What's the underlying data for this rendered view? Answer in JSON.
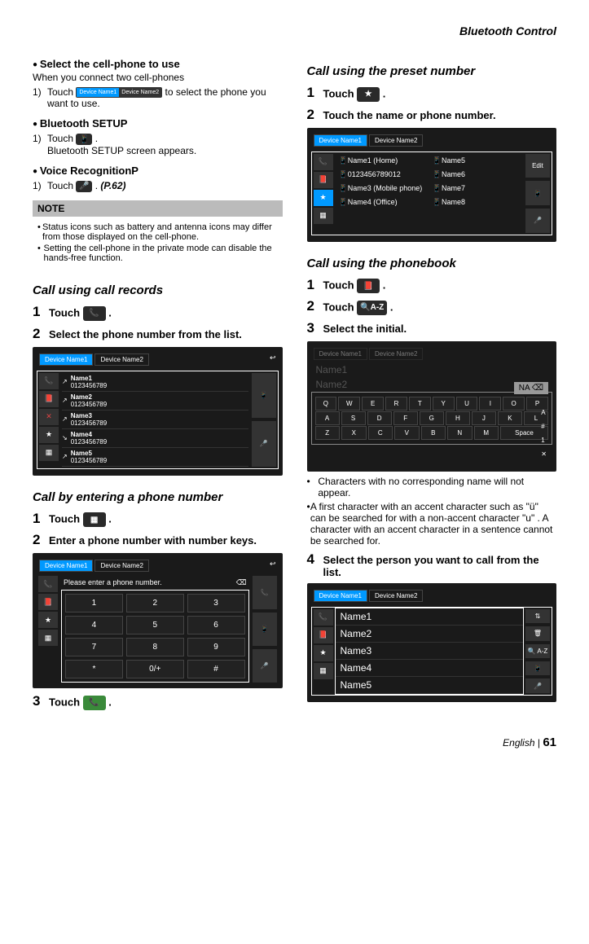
{
  "header": "Bluetooth Control",
  "left": {
    "select_phone_head": "Select the cell-phone to use",
    "select_phone_sub": "When you connect two cell-phones",
    "step1_a": "Touch ",
    "step1_b": " to select the phone you want to use.",
    "device1": "Device Name1",
    "device2": "Device Name2",
    "bt_setup": "Bluetooth SETUP",
    "bt_step_a": "Touch ",
    "bt_step_b": ".",
    "bt_setup_appears": "Bluetooth SETUP screen appears.",
    "voice_rec": "Voice RecognitionP",
    "voice_step_a": "Touch ",
    "voice_step_b": ". ",
    "voice_ref": "(P.62)",
    "note_head": "NOTE",
    "note1": "Status icons such as battery and antenna icons may differ from those displayed on the cell-phone.",
    "note2": "Setting the cell-phone in the private mode can disable the hands-free function.",
    "call_records_head": "Call using call records",
    "call_records_step1": "Touch ",
    "call_records_step2": "Select the phone number from the list.",
    "list": [
      "Name1",
      "0123456789",
      "Name2",
      "0123456789",
      "Name3",
      "0123456789",
      "Name4",
      "0123456789",
      "Name5",
      "0123456789"
    ],
    "call_enter_head": "Call by entering a phone number",
    "call_enter_step1": "Touch ",
    "call_enter_step2": "Enter a phone number with number keys.",
    "enter_prompt": "Please enter a phone number.",
    "keypad": [
      "1",
      "2",
      "3",
      "4",
      "5",
      "6",
      "7",
      "8",
      "9",
      "*",
      "0/+",
      "#"
    ],
    "call_enter_step3": "Touch "
  },
  "right": {
    "preset_head": "Call using the preset number",
    "preset_step1": "Touch ",
    "preset_step2": "Touch the name or phone number.",
    "preset_rows_l": [
      "Name1 (Home)",
      "0123456789012",
      "Name3 (Mobile phone)",
      "Name4 (Office)"
    ],
    "preset_rows_r": [
      "Name5",
      "Name6",
      "Name7",
      "Name8"
    ],
    "edit_btn": "Edit",
    "phonebook_head": "Call using the phonebook",
    "pb_step1": "Touch ",
    "pb_step2_a": "Touch ",
    "pb_step2_b": "A-Z",
    "pb_step3": "Select the initial.",
    "name_faint1": "Name1",
    "name_faint2": "Name2",
    "search_txt": "NA",
    "kb_r1": [
      "Q",
      "W",
      "E",
      "R",
      "T",
      "Y",
      "U",
      "I",
      "O",
      "P"
    ],
    "kb_r2": [
      "A",
      "S",
      "D",
      "F",
      "G",
      "H",
      "J",
      "K",
      "L"
    ],
    "kb_r3": [
      "Z",
      "X",
      "C",
      "V",
      "B",
      "N",
      "M",
      "Space"
    ],
    "bullet1": "Characters with no corresponding name will not appear.",
    "bullet2": "A first character with an accent character such as \"ü\" can be searched for with a non-accent character \"u\" . A character with an accent character in a sentence cannot be searched for.",
    "pb_step4": "Select the person you want to call from the list.",
    "names": [
      "Name1",
      "Name2",
      "Name3",
      "Name4",
      "Name5"
    ]
  },
  "footer": {
    "lang": "English",
    "page": "61"
  }
}
